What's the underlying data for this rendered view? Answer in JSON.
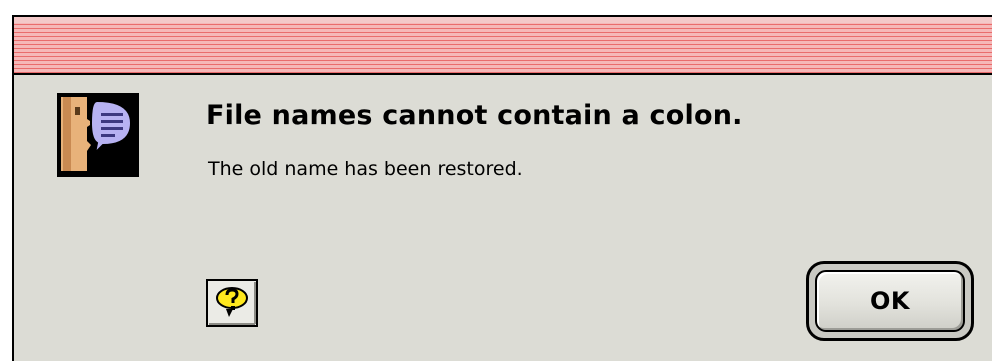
{
  "dialog": {
    "title": "",
    "message": "File names cannot contain a colon.",
    "detail": "The old name has been restored.",
    "icon": "note-alert-icon",
    "help_icon": "help-icon",
    "ok_label": "OK",
    "colors": {
      "titlebar_stripe": "#e96c6c",
      "titlebar_bg": "#f5b8b8",
      "dialog_bg": "#dcdcd5"
    }
  }
}
